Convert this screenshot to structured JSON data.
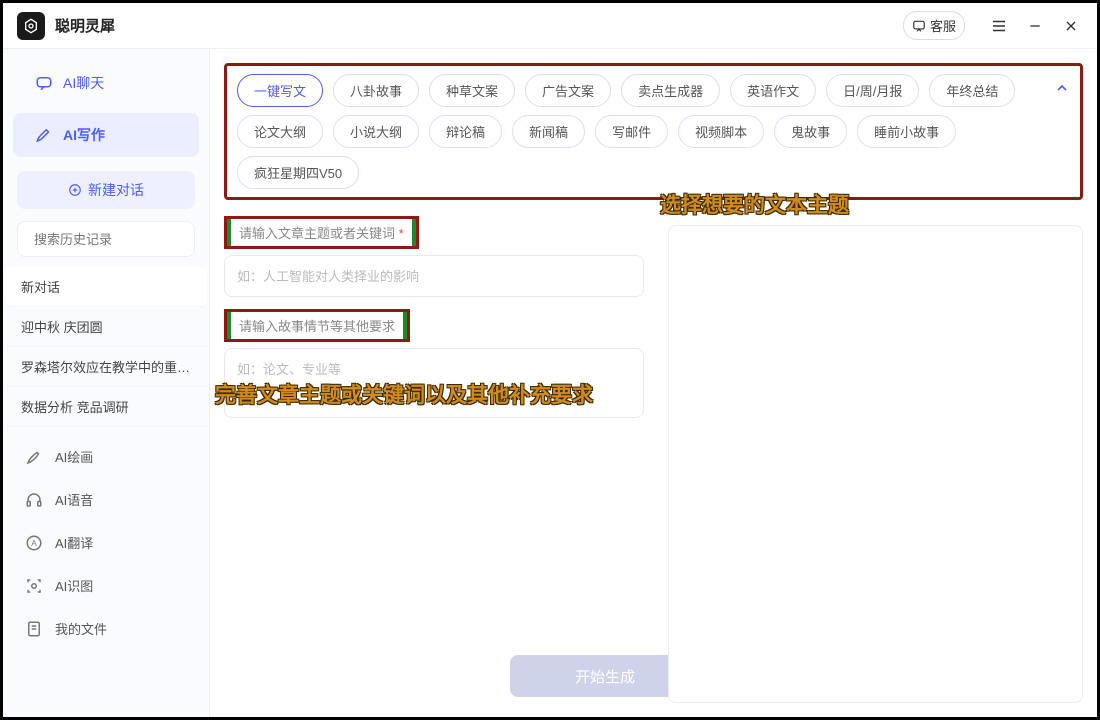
{
  "titlebar": {
    "app_name": "聪明灵犀",
    "support_label": "客服"
  },
  "sidebar": {
    "tabs": [
      {
        "label": "AI聊天"
      },
      {
        "label": "AI写作"
      }
    ],
    "new_chat_label": "新建对话",
    "search_placeholder": "搜索历史记录",
    "history": [
      "新对话",
      "迎中秋 庆团圆",
      "罗森塔尔效应在教学中的重要…",
      "数据分析 竞品调研"
    ],
    "tools": [
      "AI绘画",
      "AI语音",
      "AI翻译",
      "AI识图",
      "我的文件"
    ]
  },
  "topics": {
    "items": [
      "一键写文",
      "八卦故事",
      "种草文案",
      "广告文案",
      "卖点生成器",
      "英语作文",
      "日/周/月报",
      "年终总结",
      "论文大纲",
      "小说大纲",
      "辩论稿",
      "新闻稿",
      "写邮件",
      "视频脚本",
      "鬼故事",
      "睡前小故事",
      "疯狂星期四V50"
    ],
    "active_index": 0
  },
  "form": {
    "label1": "请输入文章主题或者关键词",
    "label1_required": "*",
    "placeholder1": "如：人工智能对人类择业的影响",
    "label2": "请输入故事情节等其他要求",
    "placeholder2": "如：论文、专业等",
    "generate_label": "开始生成"
  },
  "annotations": {
    "a1": "选择想要的文本主题",
    "a2": "完善文章主题或关键词以及其他补充要求"
  }
}
